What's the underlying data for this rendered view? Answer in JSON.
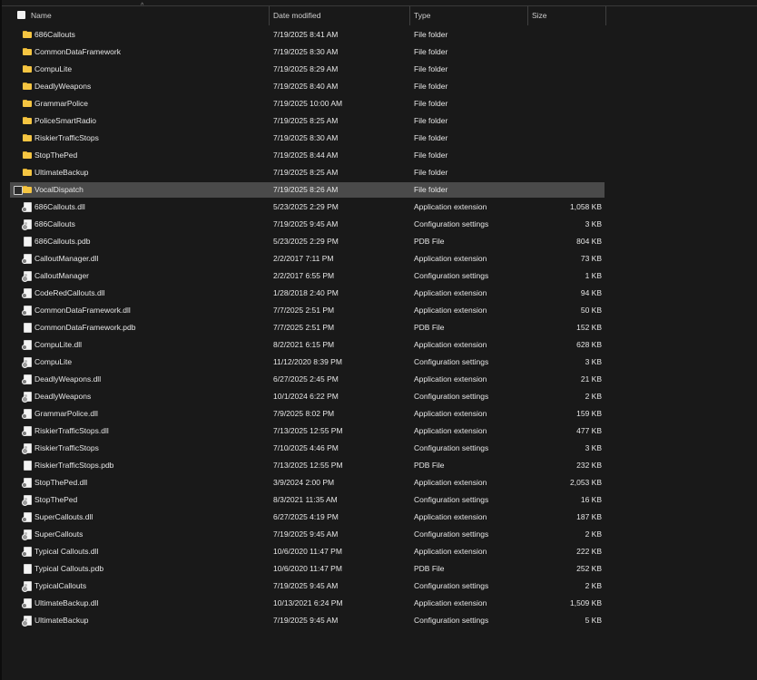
{
  "header": {
    "name": "Name",
    "date_modified": "Date modified",
    "type": "Type",
    "size": "Size",
    "sort_caret": "^"
  },
  "rows": [
    {
      "name": "686Callouts",
      "date": "7/19/2025 8:41 AM",
      "type": "File folder",
      "size": "",
      "icon": "folder-icon"
    },
    {
      "name": "CommonDataFramework",
      "date": "7/19/2025 8:30 AM",
      "type": "File folder",
      "size": "",
      "icon": "folder-icon"
    },
    {
      "name": "CompuLite",
      "date": "7/19/2025 8:29 AM",
      "type": "File folder",
      "size": "",
      "icon": "folder-icon"
    },
    {
      "name": "DeadlyWeapons",
      "date": "7/19/2025 8:40 AM",
      "type": "File folder",
      "size": "",
      "icon": "folder-icon"
    },
    {
      "name": "GrammarPolice",
      "date": "7/19/2025 10:00 AM",
      "type": "File folder",
      "size": "",
      "icon": "folder-icon"
    },
    {
      "name": "PoliceSmartRadio",
      "date": "7/19/2025 8:25 AM",
      "type": "File folder",
      "size": "",
      "icon": "folder-icon"
    },
    {
      "name": "RiskierTrafficStops",
      "date": "7/19/2025 8:30 AM",
      "type": "File folder",
      "size": "",
      "icon": "folder-icon"
    },
    {
      "name": "StopThePed",
      "date": "7/19/2025 8:44 AM",
      "type": "File folder",
      "size": "",
      "icon": "folder-icon"
    },
    {
      "name": "UltimateBackup",
      "date": "7/19/2025 8:25 AM",
      "type": "File folder",
      "size": "",
      "icon": "folder-icon"
    },
    {
      "name": "VocalDispatch",
      "date": "7/19/2025 8:26 AM",
      "type": "File folder",
      "size": "",
      "icon": "folder-icon",
      "selected": true
    },
    {
      "name": "686Callouts.dll",
      "date": "5/23/2025 2:29 PM",
      "type": "Application extension",
      "size": "1,058 KB",
      "icon": "dll-file-icon"
    },
    {
      "name": "686Callouts",
      "date": "7/19/2025 9:45 AM",
      "type": "Configuration settings",
      "size": "3 KB",
      "icon": "config-file-icon"
    },
    {
      "name": "686Callouts.pdb",
      "date": "5/23/2025 2:29 PM",
      "type": "PDB File",
      "size": "804 KB",
      "icon": "file-icon"
    },
    {
      "name": "CalloutManager.dll",
      "date": "2/2/2017 7:11 PM",
      "type": "Application extension",
      "size": "73 KB",
      "icon": "dll-file-icon"
    },
    {
      "name": "CalloutManager",
      "date": "2/2/2017 6:55 PM",
      "type": "Configuration settings",
      "size": "1 KB",
      "icon": "config-file-icon"
    },
    {
      "name": "CodeRedCallouts.dll",
      "date": "1/28/2018 2:40 PM",
      "type": "Application extension",
      "size": "94 KB",
      "icon": "dll-file-icon"
    },
    {
      "name": "CommonDataFramework.dll",
      "date": "7/7/2025 2:51 PM",
      "type": "Application extension",
      "size": "50 KB",
      "icon": "dll-file-icon"
    },
    {
      "name": "CommonDataFramework.pdb",
      "date": "7/7/2025 2:51 PM",
      "type": "PDB File",
      "size": "152 KB",
      "icon": "file-icon"
    },
    {
      "name": "CompuLite.dll",
      "date": "8/2/2021 6:15 PM",
      "type": "Application extension",
      "size": "628 KB",
      "icon": "dll-file-icon"
    },
    {
      "name": "CompuLite",
      "date": "11/12/2020 8:39 PM",
      "type": "Configuration settings",
      "size": "3 KB",
      "icon": "config-file-icon"
    },
    {
      "name": "DeadlyWeapons.dll",
      "date": "6/27/2025 2:45 PM",
      "type": "Application extension",
      "size": "21 KB",
      "icon": "dll-file-icon"
    },
    {
      "name": "DeadlyWeapons",
      "date": "10/1/2024 6:22 PM",
      "type": "Configuration settings",
      "size": "2 KB",
      "icon": "config-file-icon"
    },
    {
      "name": "GrammarPolice.dll",
      "date": "7/9/2025 8:02 PM",
      "type": "Application extension",
      "size": "159 KB",
      "icon": "dll-file-icon"
    },
    {
      "name": "RiskierTrafficStops.dll",
      "date": "7/13/2025 12:55 PM",
      "type": "Application extension",
      "size": "477 KB",
      "icon": "dll-file-icon"
    },
    {
      "name": "RiskierTrafficStops",
      "date": "7/10/2025 4:46 PM",
      "type": "Configuration settings",
      "size": "3 KB",
      "icon": "config-file-icon"
    },
    {
      "name": "RiskierTrafficStops.pdb",
      "date": "7/13/2025 12:55 PM",
      "type": "PDB File",
      "size": "232 KB",
      "icon": "file-icon"
    },
    {
      "name": "StopThePed.dll",
      "date": "3/9/2024 2:00 PM",
      "type": "Application extension",
      "size": "2,053 KB",
      "icon": "dll-file-icon"
    },
    {
      "name": "StopThePed",
      "date": "8/3/2021 11:35 AM",
      "type": "Configuration settings",
      "size": "16 KB",
      "icon": "config-file-icon"
    },
    {
      "name": "SuperCallouts.dll",
      "date": "6/27/2025 4:19 PM",
      "type": "Application extension",
      "size": "187 KB",
      "icon": "dll-file-icon"
    },
    {
      "name": "SuperCallouts",
      "date": "7/19/2025 9:45 AM",
      "type": "Configuration settings",
      "size": "2 KB",
      "icon": "config-file-icon"
    },
    {
      "name": "Typical Callouts.dll",
      "date": "10/6/2020 11:47 PM",
      "type": "Application extension",
      "size": "222 KB",
      "icon": "dll-file-icon"
    },
    {
      "name": "Typical Callouts.pdb",
      "date": "10/6/2020 11:47 PM",
      "type": "PDB File",
      "size": "252 KB",
      "icon": "file-icon"
    },
    {
      "name": "TypicalCallouts",
      "date": "7/19/2025 9:45 AM",
      "type": "Configuration settings",
      "size": "2 KB",
      "icon": "config-file-icon"
    },
    {
      "name": "UltimateBackup.dll",
      "date": "10/13/2021 6:24 PM",
      "type": "Application extension",
      "size": "1,509 KB",
      "icon": "dll-file-icon"
    },
    {
      "name": "UltimateBackup",
      "date": "7/19/2025 9:45 AM",
      "type": "Configuration settings",
      "size": "5 KB",
      "icon": "config-file-icon"
    }
  ],
  "colors": {
    "background": "#191919",
    "selected_row": "#4a4a4a",
    "folder": "#f5c542",
    "text": "#e6e6e6"
  }
}
